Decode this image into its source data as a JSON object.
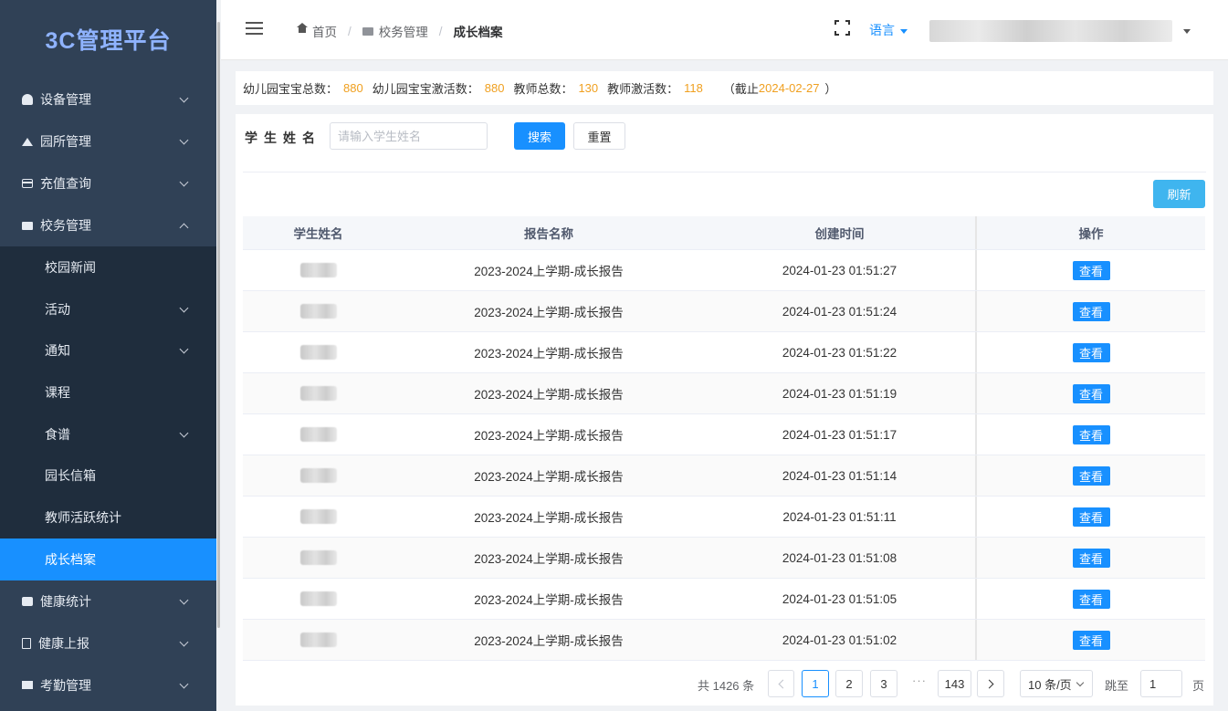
{
  "brand": "3C管理平台",
  "sidebar": {
    "items": [
      {
        "label": "设备管理",
        "icon": "device-icon"
      },
      {
        "label": "园所管理",
        "icon": "school-icon"
      },
      {
        "label": "充值查询",
        "icon": "card-icon"
      },
      {
        "label": "校务管理",
        "icon": "mail-icon",
        "expanded": true
      },
      {
        "label": "健康统计",
        "icon": "health-icon"
      },
      {
        "label": "健康上报",
        "icon": "report-icon"
      },
      {
        "label": "考勤管理",
        "icon": "attendance-icon"
      }
    ],
    "sub_items": [
      {
        "label": "校园新闻"
      },
      {
        "label": "活动"
      },
      {
        "label": "通知"
      },
      {
        "label": "课程"
      },
      {
        "label": "食谱"
      },
      {
        "label": "园长信箱"
      },
      {
        "label": "教师活跃统计"
      },
      {
        "label": "成长档案",
        "active": true
      }
    ]
  },
  "header": {
    "breadcrumb": [
      "首页",
      "校务管理",
      "成长档案"
    ],
    "language": "语言"
  },
  "stats": {
    "kids_total_label": "幼儿园宝宝总数：",
    "kids_total": "880",
    "kids_active_label": "幼儿园宝宝激活数：",
    "kids_active": "880",
    "teachers_total_label": "教师总数：",
    "teachers_total": "130",
    "teachers_active_label": "教师激活数：",
    "teachers_active": "118",
    "asof_prefix": "（截止",
    "asof_date": "2024-02-27",
    "asof_suffix": "）"
  },
  "search": {
    "label": "学生姓名",
    "placeholder": "请输入学生姓名",
    "value": "",
    "search_button": "搜索",
    "reset_button": "重置",
    "refresh_button": "刷新"
  },
  "table": {
    "headers": [
      "学生姓名",
      "报告名称",
      "创建时间",
      "操作"
    ],
    "view_label": "查看",
    "rows": [
      {
        "report": "2023-2024上学期-成长报告",
        "created": "2024-01-23 01:51:27"
      },
      {
        "report": "2023-2024上学期-成长报告",
        "created": "2024-01-23 01:51:24"
      },
      {
        "report": "2023-2024上学期-成长报告",
        "created": "2024-01-23 01:51:22"
      },
      {
        "report": "2023-2024上学期-成长报告",
        "created": "2024-01-23 01:51:19"
      },
      {
        "report": "2023-2024上学期-成长报告",
        "created": "2024-01-23 01:51:17"
      },
      {
        "report": "2023-2024上学期-成长报告",
        "created": "2024-01-23 01:51:14"
      },
      {
        "report": "2023-2024上学期-成长报告",
        "created": "2024-01-23 01:51:11"
      },
      {
        "report": "2023-2024上学期-成长报告",
        "created": "2024-01-23 01:51:08"
      },
      {
        "report": "2023-2024上学期-成长报告",
        "created": "2024-01-23 01:51:05"
      },
      {
        "report": "2023-2024上学期-成长报告",
        "created": "2024-01-23 01:51:02"
      }
    ]
  },
  "pagination": {
    "total": "共 1426 条",
    "pages": [
      "1",
      "2",
      "3",
      "143"
    ],
    "current": "1",
    "ellipsis": "···",
    "page_size": "10 条/页",
    "jump_label": "跳至",
    "jump_value": "1",
    "page_suffix": "页"
  },
  "colors": {
    "sidebar_bg": "#304156",
    "accent": "#1890ff",
    "stat_number": "#f0a020",
    "refresh_button": "#3fb5ef"
  }
}
